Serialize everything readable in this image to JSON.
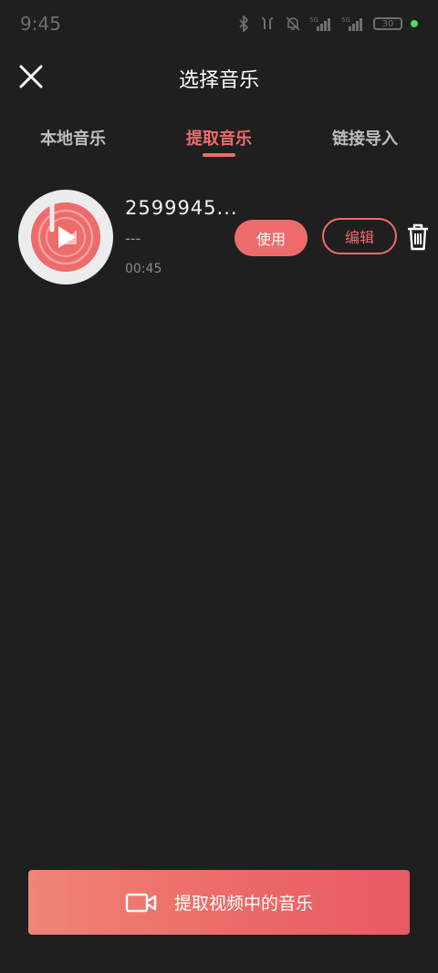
{
  "status_bar": {
    "time": "9:45",
    "battery": "30",
    "indicator_color": "#4cd964"
  },
  "header": {
    "title": "选择音乐"
  },
  "tabs": [
    {
      "label": "本地音乐",
      "active": false
    },
    {
      "label": "提取音乐",
      "active": true
    },
    {
      "label": "链接导入",
      "active": false
    }
  ],
  "track": {
    "title": "2599945...",
    "artist": "---",
    "duration": "00:45",
    "use_label": "使用",
    "edit_label": "编辑"
  },
  "extract": {
    "label": "提取视频中的音乐"
  },
  "colors": {
    "accent": "#ee6b6b",
    "background": "#1f1f1f"
  }
}
